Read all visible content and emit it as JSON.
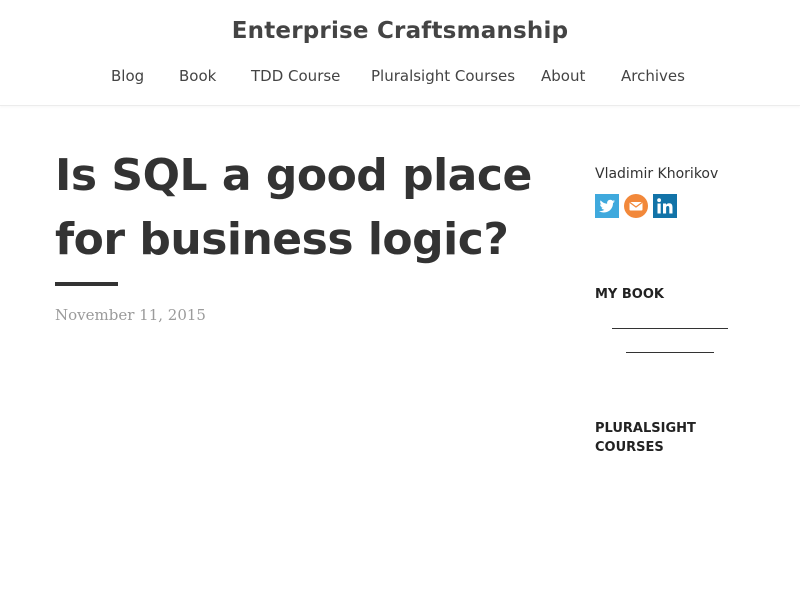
{
  "site": {
    "title": "Enterprise Craftsmanship"
  },
  "nav": {
    "items": [
      {
        "label": "Blog"
      },
      {
        "label": "Book"
      },
      {
        "label": "TDD Course"
      },
      {
        "label": "Pluralsight Courses"
      },
      {
        "label": "About"
      },
      {
        "label": "Archives"
      }
    ]
  },
  "post": {
    "title_line1": "Is SQL a good place",
    "title_line2": "for business logic?",
    "date": "November 11, 2015"
  },
  "sidebar": {
    "author": "Vladimir Khorikov",
    "social": [
      {
        "icon": "twitter-icon",
        "color": "#3fa9dd"
      },
      {
        "icon": "email-icon",
        "color": "#f2883a"
      },
      {
        "icon": "linkedin-icon",
        "color": "#1273a8"
      }
    ],
    "my_book_heading": "MY BOOK",
    "pluralsight_heading_line1": "PLURALSIGHT",
    "pluralsight_heading_line2": "COURSES"
  }
}
